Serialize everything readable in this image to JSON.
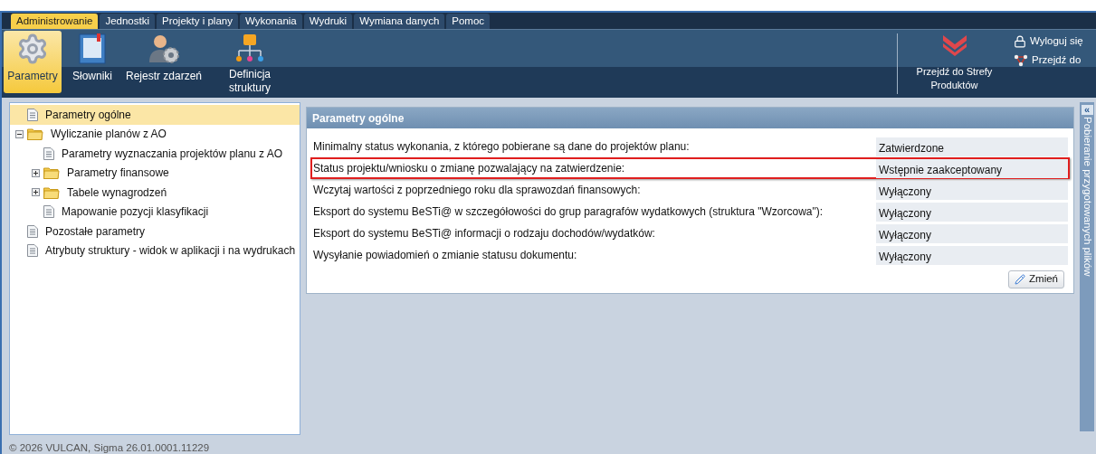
{
  "menu_tabs": [
    {
      "label": "Administrowanie",
      "selected": true
    },
    {
      "label": "Jednostki",
      "selected": false
    },
    {
      "label": "Projekty i plany",
      "selected": false
    },
    {
      "label": "Wykonania",
      "selected": false
    },
    {
      "label": "Wydruki",
      "selected": false
    },
    {
      "label": "Wymiana danych",
      "selected": false
    },
    {
      "label": "Pomoc",
      "selected": false
    }
  ],
  "toolbar": [
    {
      "label": "Parametry",
      "kind": "gear",
      "selected": true
    },
    {
      "label": "Słowniki",
      "kind": "book",
      "selected": false
    },
    {
      "label": "Rejestr zdarzeń",
      "kind": "user",
      "selected": false
    },
    {
      "label": "Definicja struktury",
      "kind": "tree",
      "selected": false
    }
  ],
  "products_button": {
    "label": "Przejdź do Strefy Produktów"
  },
  "user_links": [
    {
      "label": "Wyloguj się",
      "kind": "lock"
    },
    {
      "label": "Przejdź do",
      "kind": "network"
    }
  ],
  "tree": [
    {
      "label": "Parametry ogólne",
      "kind": "page",
      "selected": true
    },
    {
      "label": "Wyliczanie planów z AO",
      "kind": "folder",
      "selected": false,
      "expanded": true,
      "children": [
        {
          "label": "Parametry wyznaczania projektów planu z AO",
          "kind": "page",
          "selected": false
        },
        {
          "label": "Parametry finansowe",
          "kind": "folder",
          "selected": false,
          "expanded": false
        },
        {
          "label": "Tabele wynagrodzeń",
          "kind": "folder",
          "selected": false,
          "expanded": false
        },
        {
          "label": "Mapowanie pozycji klasyfikacji",
          "kind": "page",
          "selected": false
        }
      ]
    },
    {
      "label": "Pozostałe parametry",
      "kind": "page",
      "selected": false
    },
    {
      "label": "Atrybuty struktury - widok w aplikacji i na wydrukach",
      "kind": "page",
      "selected": false
    }
  ],
  "panel": {
    "title": "Parametry ogólne",
    "rows": [
      {
        "label": "Minimalny status wykonania, z którego pobierane są dane do projektów planu:",
        "value": "Zatwierdzone",
        "highlighted": false
      },
      {
        "label": "Status projektu/wniosku o zmianę pozwalający na zatwierdzenie:",
        "value": "Wstępnie zaakceptowany",
        "highlighted": true
      },
      {
        "label": "Wczytaj wartości z poprzedniego roku dla sprawozdań finansowych:",
        "value": "Wyłączony",
        "highlighted": false
      },
      {
        "label": "Eksport do systemu BeSTi@ w szczegółowości do grup paragrafów wydatkowych (struktura \"Wzorcowa\"):",
        "value": "Wyłączony",
        "highlighted": false
      },
      {
        "label": "Eksport do systemu BeSTi@ informacji o rodzaju dochodów/wydatków:",
        "value": "Wyłączony",
        "highlighted": false
      },
      {
        "label": "Wysyłanie powiadomień o zmianie statusu dokumentu:",
        "value": "Wyłączony",
        "highlighted": false
      }
    ],
    "button": "Zmień"
  },
  "side_panel": {
    "label": "Pobieranie przygotowanych plików",
    "toggle": "«"
  },
  "footer": "© 2026 VULCAN, Sigma 26.01.0001.11229"
}
